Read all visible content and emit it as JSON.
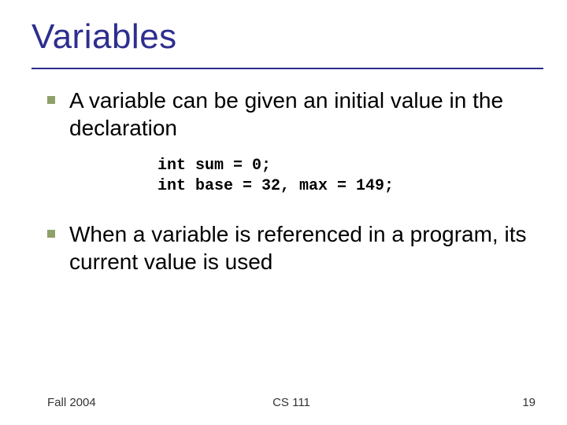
{
  "title": "Variables",
  "bullets": [
    "A variable can be given an initial value in the declaration",
    "When a variable is referenced in a program, its current value is used"
  ],
  "code": "int sum = 0;\nint base = 32, max = 149;",
  "footer": {
    "left": "Fall 2004",
    "center": "CS 111",
    "right": "19"
  }
}
